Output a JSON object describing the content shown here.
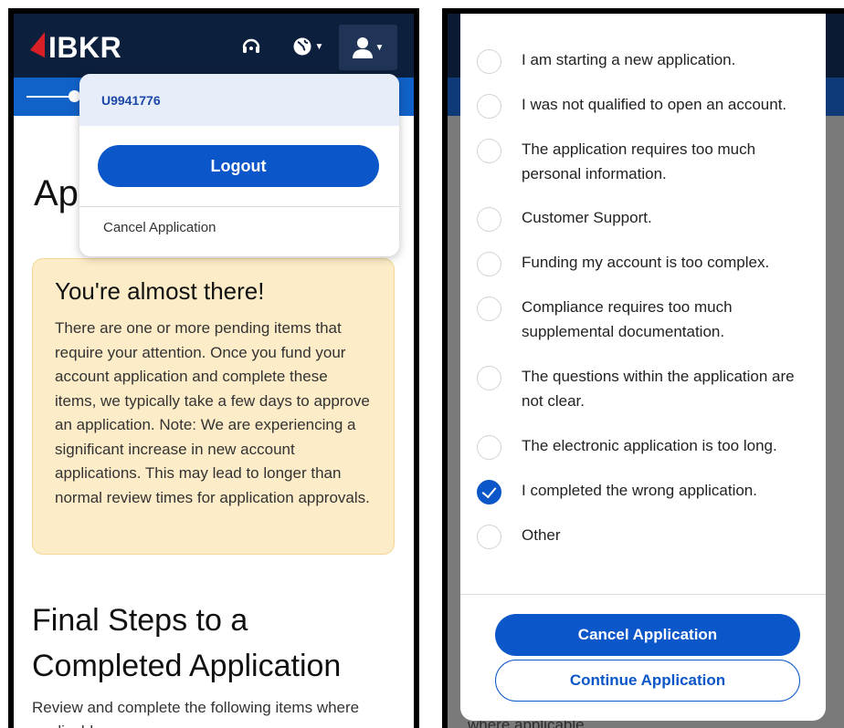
{
  "left": {
    "brand": "IBKR",
    "header_icons": [
      "headset-icon",
      "globe-icon",
      "user-icon"
    ],
    "account_menu": {
      "account_id": "U9941776",
      "logout_label": "Logout",
      "cancel_application_label": "Cancel Application"
    },
    "heading_partial": "Ap",
    "notice": {
      "title": "You're almost there!",
      "body": "There are one or more pending items that require your attention. Once you fund your account application and complete these items, we typically take a few days to approve an application. Note: We are experiencing a significant increase in new account applications. This may lead to longer than normal review times for application approvals."
    },
    "final_steps": {
      "title": "Final Steps to a Completed Application",
      "description": "Review and complete the following items where applicable."
    }
  },
  "right": {
    "reasons": [
      {
        "label": "I am starting a new application.",
        "checked": false
      },
      {
        "label": "I was not qualified to open an account.",
        "checked": false
      },
      {
        "label": "The application requires too much personal information.",
        "checked": false
      },
      {
        "label": "Customer Support.",
        "checked": false
      },
      {
        "label": "Funding my account is too complex.",
        "checked": false
      },
      {
        "label": "Compliance requires too much supplemental documentation.",
        "checked": false
      },
      {
        "label": "The questions within the application are not clear.",
        "checked": false
      },
      {
        "label": "The electronic application is too long.",
        "checked": false
      },
      {
        "label": "I completed the wrong application.",
        "checked": true
      },
      {
        "label": "Other",
        "checked": false
      }
    ],
    "cancel_button": "Cancel Application",
    "continue_button": "Continue Application",
    "background_text": "where applicable."
  },
  "colors": {
    "header_bg": "#0c1f3c",
    "brand_red": "#d81f26",
    "primary_blue": "#0b56c8",
    "notice_bg": "#fdecc8"
  }
}
